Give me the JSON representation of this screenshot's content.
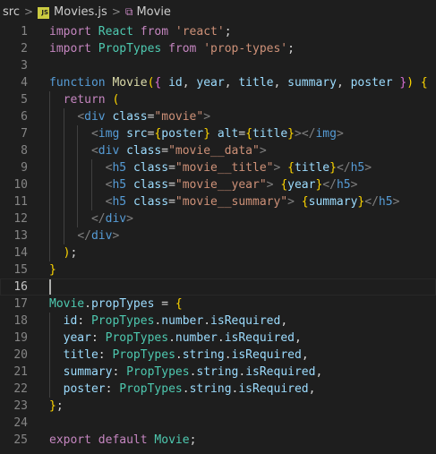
{
  "breadcrumb": {
    "folder": "src",
    "separator": ">",
    "file": "Movies.js",
    "file_icon_text": "JS",
    "symbol": "Movie"
  },
  "editor": {
    "active_line": 16,
    "line_numbers": [
      "1",
      "2",
      "3",
      "4",
      "5",
      "6",
      "7",
      "8",
      "9",
      "10",
      "11",
      "12",
      "13",
      "14",
      "15",
      "16",
      "17",
      "18",
      "19",
      "20",
      "21",
      "22",
      "23",
      "24",
      "25"
    ],
    "lines": [
      "import React from 'react';",
      "import PropTypes from 'prop-types';",
      "",
      "function Movie({ id, year, title, summary, poster }) {",
      "  return (",
      "    <div class=\"movie\">",
      "      <img src={poster} alt={title}></img>",
      "      <div class=\"movie__data\">",
      "        <h5 class=\"movie__title\"> {title}</h5>",
      "        <h5 class=\"movie__year\"> {year}</h5>",
      "        <h5 class=\"movie__summary\"> {summary}</h5>",
      "      </div>",
      "    </div>",
      "  );",
      "}",
      "",
      "Movie.propTypes = {",
      "  id: PropTypes.number.isRequired,",
      "  year: PropTypes.number.isRequired,",
      "  title: PropTypes.string.isRequired,",
      "  summary: PropTypes.string.isRequired,",
      "  poster: PropTypes.string.isRequired,",
      "};",
      "",
      "export default Movie;"
    ]
  },
  "colors": {
    "background": "#1e1e1e",
    "keyword": "#c586c0",
    "string": "#ce9178",
    "function": "#dcdcaa",
    "storage": "#569cd6",
    "variable": "#9cdcfe",
    "type": "#4ec9b0",
    "line_number": "#858585"
  }
}
